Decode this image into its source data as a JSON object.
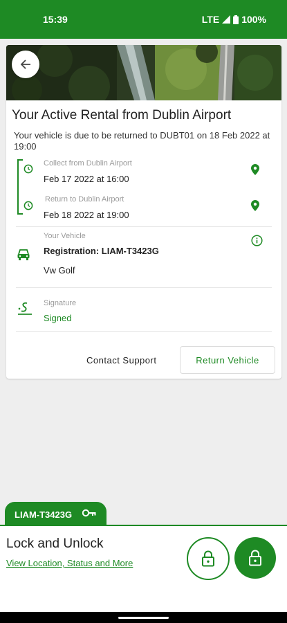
{
  "status_bar": {
    "time": "15:39",
    "network": "LTE",
    "battery": "100%"
  },
  "rental": {
    "title": "Your Active Rental from Dublin Airport",
    "subtitle": "Your vehicle is due to be returned to DUBT01 on  18 Feb 2022 at 19:00",
    "collect": {
      "label": "Collect from Dublin Airport",
      "value": "Feb 17 2022 at 16:00"
    },
    "return": {
      "label": "Return to Dublin Airport",
      "value": "Feb 18 2022 at 19:00"
    },
    "vehicle": {
      "label": "Your Vehicle",
      "registration": "Registration: LIAM-T3423G",
      "model": "Vw Golf"
    },
    "signature": {
      "label": "Signature",
      "status": "Signed"
    },
    "actions": {
      "contact_support": "Contact Support",
      "return_vehicle": "Return Vehicle"
    }
  },
  "lock_panel": {
    "registration_tab": "LIAM-T3423G",
    "title": "Lock and Unlock",
    "link": "View Location, Status and More"
  },
  "icons": {
    "back": "arrow-left-icon",
    "clock": "clock-icon",
    "pin": "location-pin-icon",
    "car": "car-icon",
    "info": "info-icon",
    "signature": "signature-icon",
    "key": "key-icon",
    "lock": "lock-icon"
  },
  "colors": {
    "brand": "#1e8a24",
    "background": "#eeeeee"
  }
}
